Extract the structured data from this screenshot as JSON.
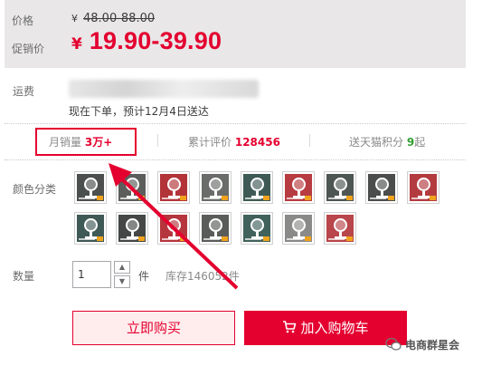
{
  "price": {
    "label": "价格",
    "currency": "¥",
    "original": "48.00-88.00",
    "promo_label": "促销价",
    "promo": "19.90-39.90"
  },
  "shipping": {
    "label": "运费",
    "delivery_text": "现在下单，预计12月4日送达"
  },
  "stats": {
    "monthly_label": "月销量",
    "monthly_value": "3万+",
    "reviews_label": "累计评价",
    "reviews_value": "128456",
    "points_label": "送天猫积分",
    "points_value": "9",
    "points_suffix": "起"
  },
  "color": {
    "label": "颜色分类",
    "swatches": [
      "#4b4f4d",
      "#5c5e5b",
      "#b23438",
      "#6a6c6a",
      "#3f5a55",
      "#b73c41",
      "#4e5654",
      "#4a4d4c",
      "#b33b40",
      "#3f5956",
      "#434746",
      "#b5363c",
      "#5a5c5a",
      "#40625b",
      "#8a8b89",
      "#b8464a"
    ]
  },
  "quantity": {
    "label": "数量",
    "value": "1",
    "unit": "件",
    "stock": "库存146052件",
    "up_glyph": "▲",
    "down_glyph": "▼"
  },
  "actions": {
    "buy_now": "立即购买",
    "add_to_cart": "加入购物车"
  },
  "watermark": {
    "text": "电商群星会"
  },
  "colors": {
    "accent": "#e4002f",
    "price_bg": "#e9e7e8",
    "points_green": "#33a133"
  }
}
